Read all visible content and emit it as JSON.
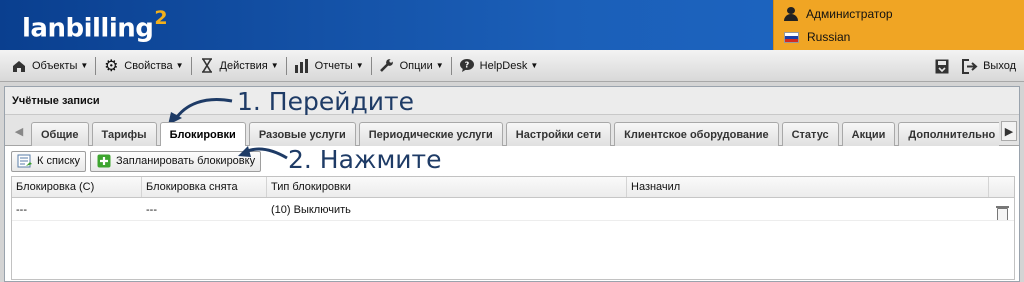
{
  "header": {
    "logo_text": "lanbilling",
    "logo_sup": "2",
    "user": "Администратор",
    "language": "Russian"
  },
  "toolbar": {
    "items": [
      {
        "label": "Объекты",
        "icon": "objects-icon"
      },
      {
        "label": "Свойства",
        "icon": "gear-icon"
      },
      {
        "label": "Действия",
        "icon": "hourglass-icon"
      },
      {
        "label": "Отчеты",
        "icon": "bar-chart-icon"
      },
      {
        "label": "Опции",
        "icon": "wrench-icon"
      },
      {
        "label": "HelpDesk",
        "icon": "helpdesk-icon"
      }
    ],
    "logout_label": "Выход"
  },
  "panel": {
    "title": "Учётные записи",
    "tabs": [
      "Общие",
      "Тарифы",
      "Блокировки",
      "Разовые услуги",
      "Периодические услуги",
      "Настройки сети",
      "Клиентское оборудование",
      "Статус",
      "Акции",
      "Дополнительно"
    ],
    "active_tab": "Блокировки",
    "buttons": {
      "back_label": "К списку",
      "schedule_label": "Запланировать блокировку"
    },
    "grid": {
      "columns": [
        "Блокировка (С)",
        "Блокировка снята",
        "Тип блокировки",
        "Назначил",
        ""
      ],
      "rows": [
        [
          "---",
          "---",
          "(10) Выключить",
          ""
        ]
      ]
    }
  },
  "annotations": {
    "step1": "1. Перейдите",
    "step2": "2. Нажмите",
    "color": "#1e3b66"
  },
  "colors": {
    "header_blue": "#1b5fb8",
    "user_orange": "#f0a524",
    "logo_accent": "#f3b01c"
  }
}
